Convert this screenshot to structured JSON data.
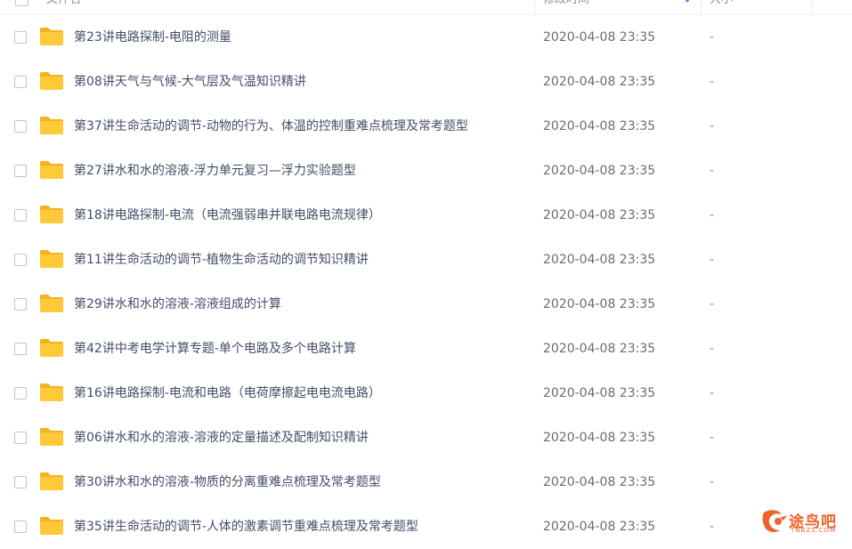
{
  "header": {
    "name_col": "文件名",
    "mtime_col": "修改时间",
    "size_col": "大小"
  },
  "colors": {
    "folder": "#ffc937",
    "folder_tab": "#f5b21e",
    "sort_accent": "#3b8cff",
    "watermark": "#f0622d"
  },
  "rows": [
    {
      "name": "第23讲电路探制-电阻的测量",
      "mtime": "2020-04-08 23:35",
      "size": "-"
    },
    {
      "name": "第08讲天气与气候-大气层及气温知识精讲",
      "mtime": "2020-04-08 23:35",
      "size": "-"
    },
    {
      "name": "第37讲生命活动的调节-动物的行为、体温的控制重难点梳理及常考题型",
      "mtime": "2020-04-08 23:35",
      "size": "-"
    },
    {
      "name": "第27讲水和水的溶液-浮力单元复习—浮力实验题型",
      "mtime": "2020-04-08 23:35",
      "size": "-"
    },
    {
      "name": "第18讲电路探制-电流（电流强弱串并联电路电流规律）",
      "mtime": "2020-04-08 23:35",
      "size": "-"
    },
    {
      "name": "第11讲生命活动的调节-植物生命活动的调节知识精讲",
      "mtime": "2020-04-08 23:35",
      "size": "-"
    },
    {
      "name": "第29讲水和水的溶液-溶液组成的计算",
      "mtime": "2020-04-08 23:35",
      "size": "-"
    },
    {
      "name": "第42讲中考电学计算专题-单个电路及多个电路计算",
      "mtime": "2020-04-08 23:35",
      "size": "-"
    },
    {
      "name": "第16讲电路探制-电流和电路（电荷摩擦起电电流电路）",
      "mtime": "2020-04-08 23:35",
      "size": "-"
    },
    {
      "name": "第06讲水和水的溶液-溶液的定量描述及配制知识精讲",
      "mtime": "2020-04-08 23:35",
      "size": "-"
    },
    {
      "name": "第30讲水和水的溶液-物质的分离重难点梳理及常考题型",
      "mtime": "2020-04-08 23:35",
      "size": "-"
    },
    {
      "name": "第35讲生命活动的调节-人体的激素调节重难点梳理及常考题型",
      "mtime": "2020-04-08 23:35",
      "size": "-"
    }
  ],
  "watermark": {
    "text": "途鸟吧",
    "sub": "TNBZS.COM"
  }
}
